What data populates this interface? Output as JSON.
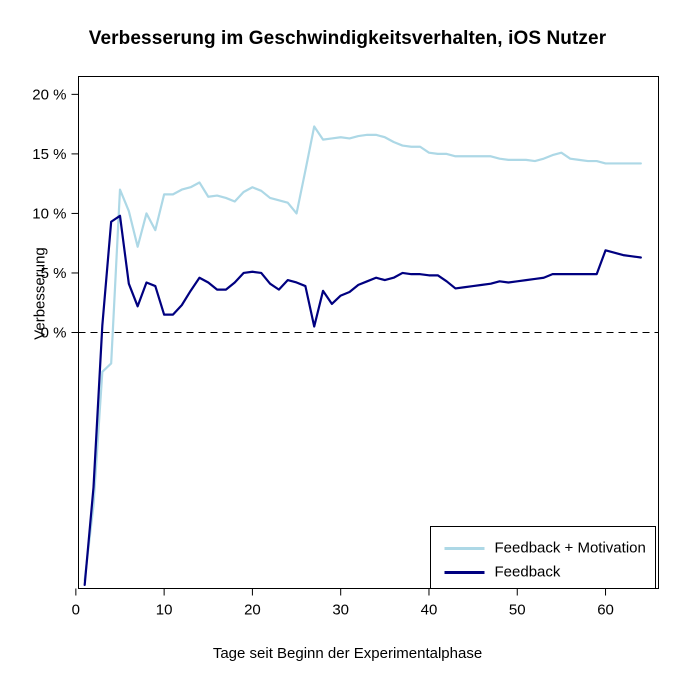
{
  "chart_data": {
    "type": "line",
    "title": "Verbesserung im Geschwindigkeitsverhalten, iOS Nutzer",
    "xlabel": "Tage seit Beginn der Experimentalphase",
    "ylabel": "Verbesserung",
    "xlim": [
      0.3,
      66
    ],
    "ylim": [
      -21.5,
      21.5
    ],
    "xticks": [
      0,
      10,
      20,
      30,
      40,
      50,
      60
    ],
    "xtick_labels": [
      "0",
      "10",
      "20",
      "30",
      "40",
      "50",
      "60"
    ],
    "yticks": [
      0,
      5,
      10,
      15,
      20
    ],
    "ytick_labels": [
      "0 %",
      "5 %",
      "10 %",
      "15 %",
      "20 %"
    ],
    "grid": false,
    "zero_reference_line": {
      "value": 0,
      "style": "dashed",
      "color": "#000000"
    },
    "legend": {
      "position": "bottom-right",
      "entries": [
        {
          "name": "Feedback + Motivation",
          "color": "#add8e6"
        },
        {
          "name": "Feedback",
          "color": "#000080"
        }
      ]
    },
    "x": [
      1,
      2,
      3,
      4,
      5,
      6,
      7,
      8,
      9,
      10,
      11,
      12,
      13,
      14,
      15,
      16,
      17,
      18,
      19,
      20,
      21,
      22,
      23,
      24,
      25,
      26,
      27,
      28,
      29,
      30,
      31,
      32,
      33,
      34,
      35,
      36,
      37,
      38,
      39,
      40,
      41,
      42,
      43,
      44,
      45,
      46,
      47,
      48,
      49,
      50,
      51,
      52,
      53,
      54,
      55,
      56,
      57,
      58,
      59,
      60,
      61,
      62,
      63,
      64
    ],
    "series": [
      {
        "name": "Feedback + Motivation",
        "color": "#add8e6",
        "values": [
          -20.8,
          -14.5,
          -3.3,
          -2.6,
          12.0,
          10.2,
          7.2,
          10.0,
          8.6,
          11.6,
          11.6,
          12.0,
          12.2,
          12.6,
          11.4,
          11.5,
          11.3,
          11.0,
          11.8,
          12.2,
          11.9,
          11.3,
          11.1,
          10.9,
          10.0,
          13.6,
          17.3,
          16.2,
          16.3,
          16.4,
          16.3,
          16.5,
          16.6,
          16.6,
          16.4,
          16.0,
          15.7,
          15.6,
          15.6,
          15.1,
          15.0,
          15.0,
          14.8,
          14.8,
          14.8,
          14.8,
          14.8,
          14.6,
          14.5,
          14.5,
          14.5,
          14.4,
          14.6,
          14.9,
          15.1,
          14.6,
          14.5,
          14.4,
          14.4,
          14.2,
          14.2,
          14.2,
          14.2,
          14.2
        ]
      },
      {
        "name": "Feedback",
        "color": "#000080",
        "values": [
          -21.2,
          -13.0,
          0.6,
          9.3,
          9.8,
          4.1,
          2.2,
          4.2,
          3.9,
          1.5,
          1.5,
          2.3,
          3.5,
          4.6,
          4.2,
          3.6,
          3.6,
          4.2,
          5.0,
          5.1,
          5.0,
          4.1,
          3.6,
          4.4,
          4.2,
          3.9,
          0.5,
          3.5,
          2.4,
          3.1,
          3.4,
          4.0,
          4.3,
          4.6,
          4.4,
          4.6,
          5.0,
          4.9,
          4.9,
          4.8,
          4.8,
          4.3,
          3.7,
          3.8,
          3.9,
          4.0,
          4.1,
          4.3,
          4.2,
          4.3,
          4.4,
          4.5,
          4.6,
          4.9,
          4.9,
          4.9,
          4.9,
          4.9,
          4.9,
          6.9,
          6.7,
          6.5,
          6.4,
          6.3
        ]
      }
    ]
  }
}
